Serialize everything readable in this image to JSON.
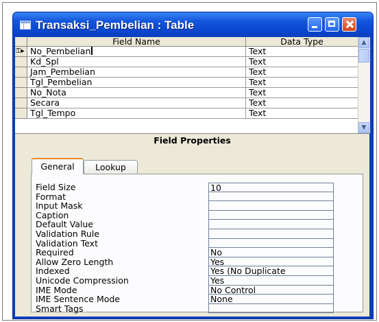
{
  "window": {
    "title": "Transaksi_Pembelian : Table"
  },
  "grid": {
    "headers": {
      "field_name": "Field Name",
      "data_type": "Data Type"
    },
    "rows": [
      {
        "name": "No_Pembelian",
        "type": "Text"
      },
      {
        "name": "Kd_Spl",
        "type": "Text"
      },
      {
        "name": "Jam_Pembelian",
        "type": "Text"
      },
      {
        "name": "Tgl_Pembelian",
        "type": "Text"
      },
      {
        "name": "No_Nota",
        "type": "Text"
      },
      {
        "name": "Secara",
        "type": "Text"
      },
      {
        "name": "Tgl_Tempo",
        "type": "Text"
      }
    ]
  },
  "field_properties": {
    "title": "Field Properties",
    "tabs": {
      "general": "General",
      "lookup": "Lookup"
    },
    "props": [
      {
        "label": "Field Size",
        "value": "10"
      },
      {
        "label": "Format",
        "value": ""
      },
      {
        "label": "Input Mask",
        "value": ""
      },
      {
        "label": "Caption",
        "value": ""
      },
      {
        "label": "Default Value",
        "value": ""
      },
      {
        "label": "Validation Rule",
        "value": ""
      },
      {
        "label": "Validation Text",
        "value": ""
      },
      {
        "label": "Required",
        "value": "No"
      },
      {
        "label": "Allow Zero Length",
        "value": "Yes"
      },
      {
        "label": "Indexed",
        "value": "Yes (No Duplicate"
      },
      {
        "label": "Unicode Compression",
        "value": "Yes"
      },
      {
        "label": "IME Mode",
        "value": "No Control"
      },
      {
        "label": "IME Sentence Mode",
        "value": "None"
      },
      {
        "label": "Smart Tags",
        "value": ""
      }
    ]
  }
}
